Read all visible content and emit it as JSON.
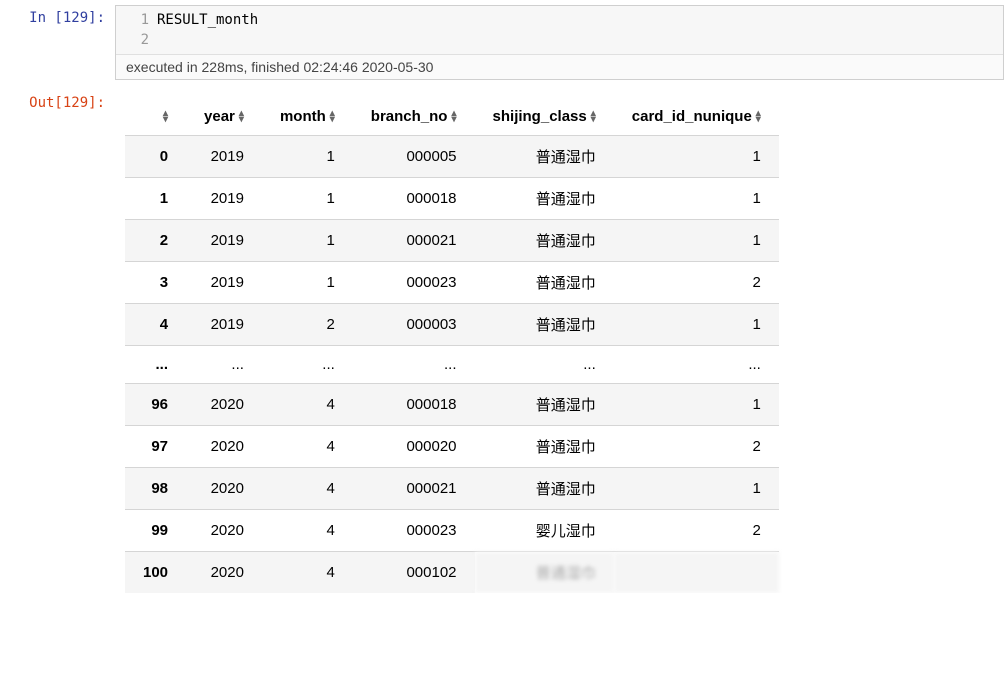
{
  "input": {
    "prompt": "In [129]:",
    "lines": [
      "RESULT_month",
      ""
    ],
    "gutter": [
      "1",
      "2"
    ]
  },
  "exec_status": "executed in 228ms, finished 02:24:46 2020-05-30",
  "output": {
    "prompt": "Out[129]:",
    "columns": [
      "",
      "year",
      "month",
      "branch_no",
      "shijing_class",
      "card_id_nunique"
    ],
    "rows": [
      {
        "idx": "0",
        "year": "2019",
        "month": "1",
        "branch_no": "000005",
        "shijing_class": "普通湿巾",
        "card_id_nunique": "1"
      },
      {
        "idx": "1",
        "year": "2019",
        "month": "1",
        "branch_no": "000018",
        "shijing_class": "普通湿巾",
        "card_id_nunique": "1"
      },
      {
        "idx": "2",
        "year": "2019",
        "month": "1",
        "branch_no": "000021",
        "shijing_class": "普通湿巾",
        "card_id_nunique": "1"
      },
      {
        "idx": "3",
        "year": "2019",
        "month": "1",
        "branch_no": "000023",
        "shijing_class": "普通湿巾",
        "card_id_nunique": "2"
      },
      {
        "idx": "4",
        "year": "2019",
        "month": "2",
        "branch_no": "000003",
        "shijing_class": "普通湿巾",
        "card_id_nunique": "1"
      }
    ],
    "ellipsis": {
      "idx": "...",
      "year": "...",
      "month": "...",
      "branch_no": "...",
      "shijing_class": "...",
      "card_id_nunique": "..."
    },
    "rows2": [
      {
        "idx": "96",
        "year": "2020",
        "month": "4",
        "branch_no": "000018",
        "shijing_class": "普通湿巾",
        "card_id_nunique": "1"
      },
      {
        "idx": "97",
        "year": "2020",
        "month": "4",
        "branch_no": "000020",
        "shijing_class": "普通湿巾",
        "card_id_nunique": "2"
      },
      {
        "idx": "98",
        "year": "2020",
        "month": "4",
        "branch_no": "000021",
        "shijing_class": "普通湿巾",
        "card_id_nunique": "1"
      },
      {
        "idx": "99",
        "year": "2020",
        "month": "4",
        "branch_no": "000023",
        "shijing_class": "婴儿湿巾",
        "card_id_nunique": "2"
      },
      {
        "idx": "100",
        "year": "2020",
        "month": "4",
        "branch_no": "000102",
        "shijing_class": "普通湿巾",
        "card_id_nunique": ""
      }
    ]
  }
}
